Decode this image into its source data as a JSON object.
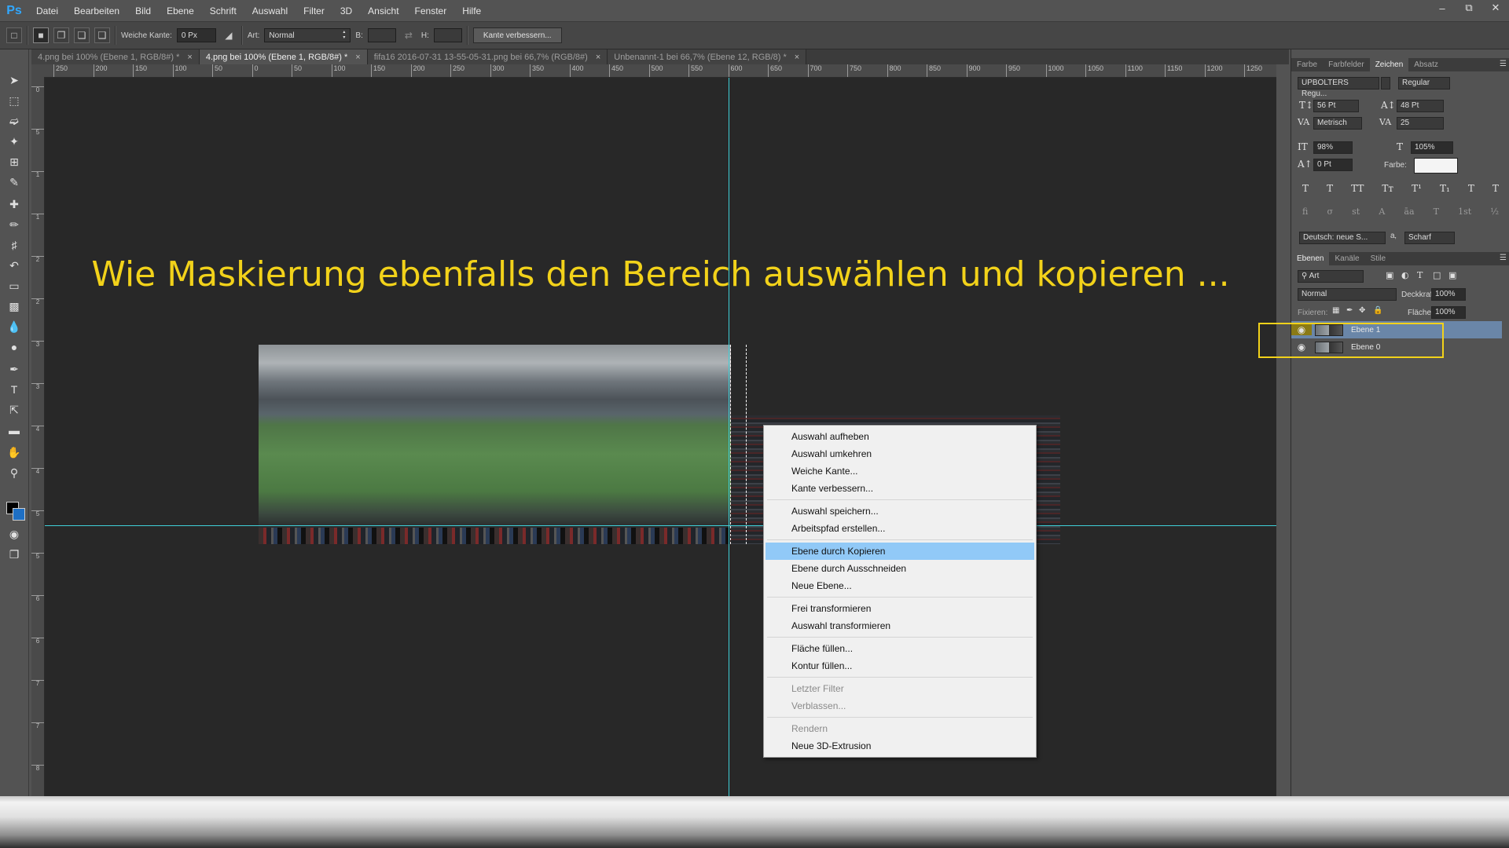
{
  "app": {
    "logo": "Ps"
  },
  "menubar": {
    "items": [
      "Datei",
      "Bearbeiten",
      "Bild",
      "Ebene",
      "Schrift",
      "Auswahl",
      "Filter",
      "3D",
      "Ansicht",
      "Fenster",
      "Hilfe"
    ]
  },
  "window_controls": {
    "minimize": "–",
    "restore": "⧉",
    "close": "✕"
  },
  "options": {
    "feather_label": "Weiche Kante:",
    "feather_value": "0 Px",
    "style_label": "Art:",
    "style_value": "Normal",
    "width_label": "B:",
    "height_label": "H:",
    "refine_button": "Kante verbessern..."
  },
  "tabs": [
    {
      "label": "4.png bei 100% (Ebene 1, RGB/8#) *"
    },
    {
      "label": "4.png bei 100% (Ebene 1, RGB/8#) *"
    },
    {
      "label": "fifa16 2016-07-31 13-55-05-31.png bei 66,7% (RGB/8#)"
    },
    {
      "label": "Unbenannt-1 bei 66,7% (Ebene 12, RGB/8) *"
    }
  ],
  "tab_close": "×",
  "ruler_h": [
    "250",
    "200",
    "150",
    "100",
    "50",
    "0",
    "50",
    "100",
    "150",
    "200",
    "250",
    "300",
    "350",
    "400",
    "450",
    "500",
    "550",
    "600",
    "650",
    "700",
    "750",
    "800",
    "850",
    "900",
    "950",
    "1000",
    "1050",
    "1100",
    "1150",
    "1200",
    "1250"
  ],
  "ruler_v": [
    "0",
    "5",
    "1",
    "1",
    "2",
    "2",
    "3",
    "3",
    "4",
    "4",
    "5",
    "5",
    "6",
    "6",
    "7",
    "7",
    "8"
  ],
  "caption": "Wie Maskierung ebenfalls den Bereich auswählen und kopieren ...",
  "context_menu": {
    "groups": [
      [
        "Auswahl aufheben",
        "Auswahl umkehren",
        "Weiche Kante...",
        "Kante verbessern..."
      ],
      [
        "Auswahl speichern...",
        "Arbeitspfad erstellen..."
      ],
      [
        "Ebene durch Kopieren",
        "Ebene durch Ausschneiden",
        "Neue Ebene..."
      ],
      [
        "Frei transformieren",
        "Auswahl transformieren"
      ],
      [
        "Fläche füllen...",
        "Kontur füllen..."
      ],
      [
        "Letzter Filter",
        "Verblassen..."
      ],
      [
        "Rendern",
        "Neue 3D-Extrusion"
      ]
    ],
    "highlighted": "Ebene durch Kopieren",
    "disabled": [
      "Letzter Filter",
      "Verblassen...",
      "Rendern"
    ]
  },
  "char_panel": {
    "tabs": [
      "Farbe",
      "Farbfelder",
      "Zeichen",
      "Absatz"
    ],
    "active_tab": "Zeichen",
    "font_family": "UPBOLTERS Regu...",
    "font_style": "Regular",
    "font_size": "56 Pt",
    "leading": "48 Pt",
    "kerning": "Metrisch",
    "tracking": "25",
    "vscale": "98%",
    "hscale": "105%",
    "baseline": "0 Pt",
    "color_label": "Farbe:",
    "language": "Deutsch: neue S...",
    "antialias": "Scharf",
    "style_buttons": [
      "T",
      "T",
      "TT",
      "Tт",
      "T¹",
      "T₁",
      "T",
      "T"
    ],
    "opentype_buttons": [
      "fi",
      "σ",
      "st",
      "A",
      "āa",
      "T",
      "1st",
      "½"
    ]
  },
  "layers_panel": {
    "tabs": [
      "Ebenen",
      "Kanäle",
      "Stile"
    ],
    "active_tab": "Ebenen",
    "filter_value": "Art",
    "blend_mode": "Normal",
    "opacity_label": "Deckkraft:",
    "opacity": "100%",
    "lock_label": "Fixieren:",
    "fill_label": "Fläche:",
    "fill": "100%",
    "layers": [
      {
        "name": "Ebene 1",
        "selected": true
      },
      {
        "name": "Ebene 0",
        "selected": false
      }
    ]
  },
  "colors": {
    "guide": "#3fd0d8",
    "caption": "#f2d21a",
    "highlight_box": "#f2d21a",
    "menu_highlight": "#91c9f7",
    "selected_layer": "#6a86a8"
  }
}
